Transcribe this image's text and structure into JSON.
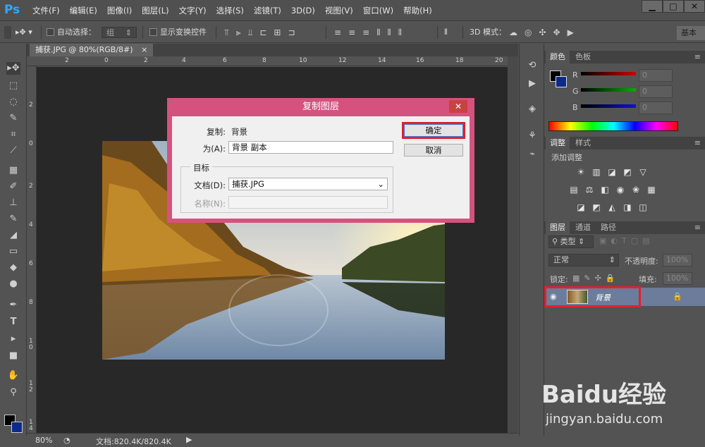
{
  "app": {
    "logo": "Ps",
    "window_controls": [
      "▁",
      "□",
      "✕"
    ]
  },
  "menu": [
    "文件(F)",
    "编辑(E)",
    "图像(I)",
    "图层(L)",
    "文字(Y)",
    "选择(S)",
    "滤镜(T)",
    "3D(D)",
    "视图(V)",
    "窗口(W)",
    "帮助(H)"
  ],
  "options": {
    "auto_select_label": "自动选择：",
    "auto_select_value": "组",
    "show_transform_label": "显示变换控件",
    "mode_3d_label": "3D 模式：",
    "workspace": "基本"
  },
  "document": {
    "tab_title": "捕获.JPG @ 80%(RGB/8#)",
    "tab_close": "×",
    "zoom": "80%",
    "doc_size": "文档:820.4K/820.4K"
  },
  "rulers": {
    "h": [
      "2",
      "0",
      "2",
      "4",
      "6",
      "8",
      "10",
      "12",
      "14",
      "16",
      "18",
      "20"
    ],
    "v": [
      "2",
      "0",
      "2",
      "4",
      "6",
      "8",
      "1 0",
      "1 2",
      "1 4"
    ]
  },
  "color_panel": {
    "tabs": [
      "颜色",
      "色板"
    ],
    "channels": [
      {
        "label": "R",
        "value": "0",
        "color": "#d00000"
      },
      {
        "label": "G",
        "value": "0",
        "color": "#00b000"
      },
      {
        "label": "B",
        "value": "0",
        "color": "#1010d0"
      }
    ]
  },
  "adjust_panel": {
    "tabs": [
      "调整",
      "样式"
    ],
    "hint": "添加调整"
  },
  "layers_panel": {
    "tabs": [
      "图层",
      "通道",
      "路径"
    ],
    "filter": "类型",
    "blend_mode": "正常",
    "opacity_label": "不透明度:",
    "opacity_value": "100%",
    "lock_label": "锁定:",
    "fill_label": "填充:",
    "fill_value": "100%",
    "layer_name": "背景",
    "highlight_color": "#e2202c"
  },
  "dialog": {
    "title": "复制图层",
    "close": "✕",
    "copy_label": "复制:",
    "copy_value": "背景",
    "as_label": "为(A):",
    "as_value": "背景 副本",
    "group_label": "目标",
    "doc_label": "文档(D):",
    "doc_value": "捕获.JPG",
    "name_label": "名称(N):",
    "ok": "确定",
    "cancel": "取消"
  },
  "watermark": {
    "text": "Baidu经验",
    "url": "jingyan.baidu.com"
  }
}
